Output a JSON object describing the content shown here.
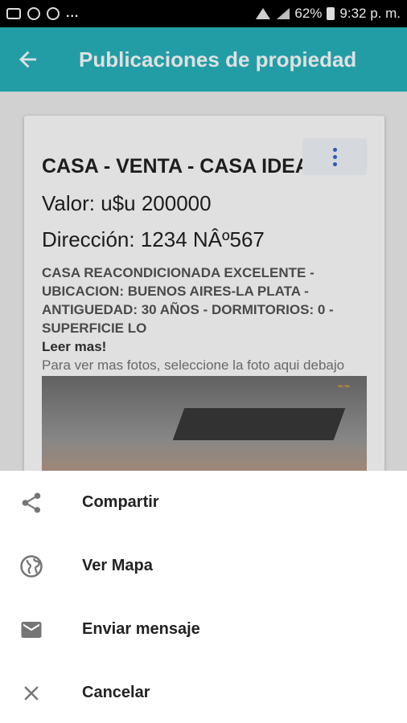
{
  "status_bar": {
    "left_more": "...",
    "battery": "62%",
    "time": "9:32 p. m."
  },
  "app_bar": {
    "back_icon": "arrow-back-icon",
    "title": "Publicaciones de propiedad"
  },
  "card": {
    "menu_icon": "more-vert-icon",
    "title": "CASA - VENTA - CASA IDEAL",
    "price": "Valor: u$u 200000",
    "address": "Dirección: 1234 NÂº567",
    "description": "CASA REACONDICIONADA EXCELENTE - UBICACION: BUENOS AIRES-LA PLATA - ANTIGUEDAD: 30 AÑOS - DORMITORIOS: 0 - SUPERFICIE LO",
    "read_more": "Leer mas!",
    "photo_hint": "Para ver mas fotos, seleccione la foto aqui debajo"
  },
  "bottom_sheet": {
    "items": [
      {
        "label": "Compartir",
        "icon": "share-icon"
      },
      {
        "label": "Ver Mapa",
        "icon": "globe-icon"
      },
      {
        "label": "Enviar mensaje",
        "icon": "email-icon"
      },
      {
        "label": "Cancelar",
        "icon": "close-icon"
      }
    ]
  },
  "colors": {
    "app_bar": "#27b3be",
    "menu_icon": "#2f67d8",
    "status_bar": "#000000"
  }
}
